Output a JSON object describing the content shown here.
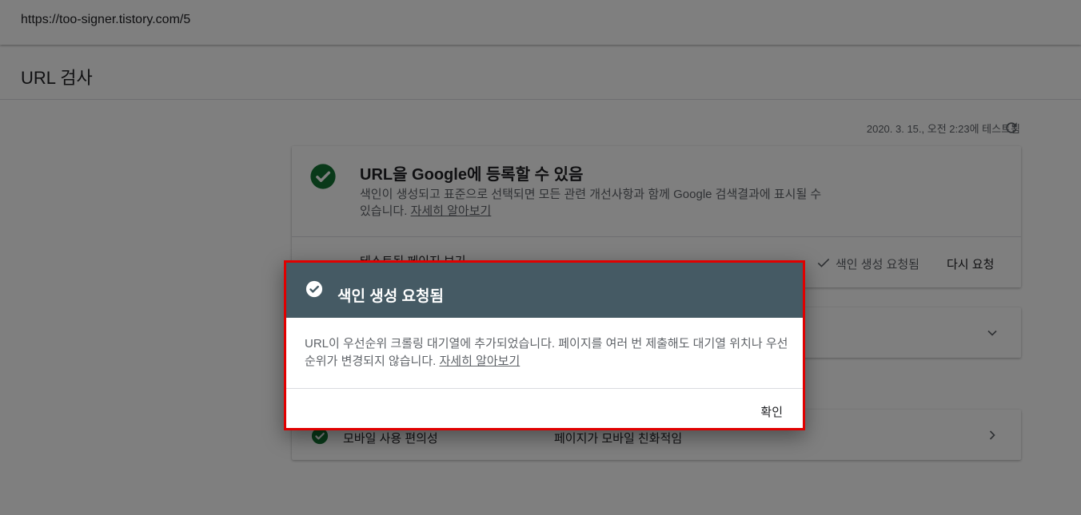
{
  "address_bar": {
    "url": "https://too-signer.tistory.com/5"
  },
  "page": {
    "title": "URL 검사"
  },
  "test_info": {
    "timestamp": "2020. 3. 15., 오전 2:23에 테스트됨"
  },
  "status_card": {
    "title": "URL을 Google에 등록할 수 있음",
    "description": "색인이 생성되고 표준으로 선택되면 모든 관련 개선사항과 함께 Google 검색결과에 표시될 수 있습니다.",
    "learn_more": "자세히 알아보기",
    "view_tested_page": "테스트된 페이지 보기",
    "indexing_requested": "색인 생성 요청됨",
    "request_again": "다시 요청",
    "status_color": "#137333"
  },
  "mobile_card": {
    "label": "모바일 사용 편의성",
    "status": "페이지가 모바일 친화적임"
  },
  "dialog": {
    "title": "색인 생성 요청됨",
    "body": "URL이 우선순위 크롤링 대기열에 추가되었습니다. 페이지를 여러 번 제출해도 대기열 위치나 우선순위가 변경되지 않습니다.",
    "learn_more": "자세히 알아보기",
    "ok": "확인",
    "header_color": "#455a64",
    "highlight_color": "#e00000"
  }
}
